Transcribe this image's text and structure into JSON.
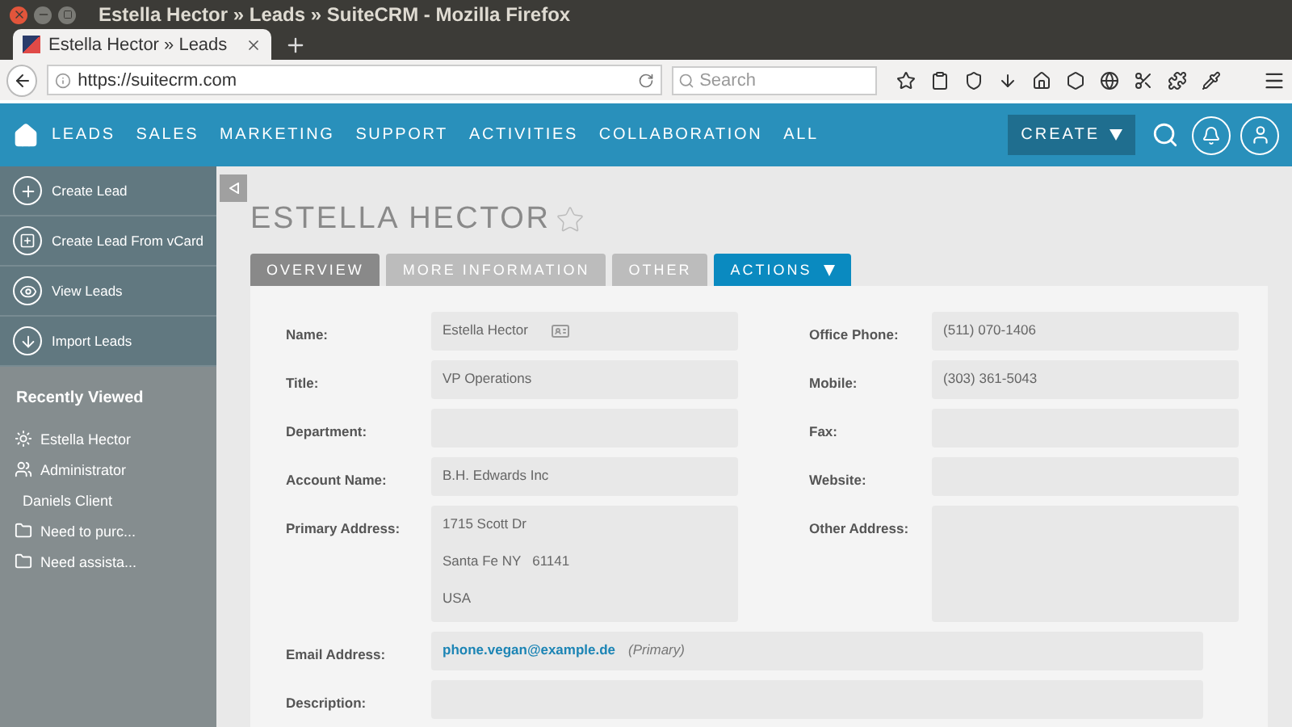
{
  "browser": {
    "window_title": "Estella Hector » Leads » SuiteCRM - Mozilla Firefox",
    "tab_title": "Estella Hector » Leads",
    "url": "https://suitecrm.com",
    "search_placeholder": "Search"
  },
  "nav": {
    "items": [
      "LEADS",
      "SALES",
      "MARKETING",
      "SUPPORT",
      "ACTIVITIES",
      "COLLABORATION",
      "ALL"
    ],
    "create": "CREATE"
  },
  "sidebar": {
    "actions": [
      {
        "label": "Create Lead",
        "kind": "plus"
      },
      {
        "label": "Create Lead From vCard",
        "kind": "vcard"
      },
      {
        "label": "View Leads",
        "kind": "eye"
      },
      {
        "label": "Import Leads",
        "kind": "download"
      }
    ],
    "recently_viewed_title": "Recently Viewed",
    "recently_viewed": [
      {
        "label": "Estella Hector",
        "kind": "lead"
      },
      {
        "label": "Administrator",
        "kind": "user"
      },
      {
        "label": "Daniels Client",
        "kind": "none"
      },
      {
        "label": "Need to purc...",
        "kind": "folder"
      },
      {
        "label": "Need assista...",
        "kind": "folder"
      }
    ]
  },
  "record": {
    "title": "ESTELLA HECTOR",
    "favorite": false,
    "tabs": [
      {
        "label": "OVERVIEW",
        "selected": true,
        "kind": "tab"
      },
      {
        "label": "MORE INFORMATION",
        "selected": false,
        "kind": "tab"
      },
      {
        "label": "OTHER",
        "selected": false,
        "kind": "tab"
      },
      {
        "label": "ACTIONS",
        "selected": false,
        "kind": "menu"
      }
    ],
    "rows": [
      {
        "cells": [
          {
            "label": "Name:",
            "kind": "text",
            "value": "Estella Hector",
            "vcard": true
          },
          {
            "label": "Office Phone:",
            "kind": "text",
            "value": "(511) 070-1406"
          }
        ]
      },
      {
        "cells": [
          {
            "label": "Title:",
            "kind": "text",
            "value": "VP Operations"
          },
          {
            "label": "Mobile:",
            "kind": "text",
            "value": "(303) 361-5043"
          }
        ]
      },
      {
        "cells": [
          {
            "label": "Department:",
            "kind": "text"
          },
          {
            "label": "Fax:",
            "kind": "text"
          }
        ]
      },
      {
        "cells": [
          {
            "label": "Account Name:",
            "kind": "text",
            "value": "B.H. Edwards Inc"
          },
          {
            "label": "Website:",
            "kind": "text"
          }
        ]
      },
      {
        "cells": [
          {
            "label": "Primary Address:",
            "kind": "address",
            "lines": [
              "1715 Scott Dr",
              "Santa Fe NY   61141",
              "USA"
            ]
          },
          {
            "label": "Other Address:",
            "kind": "address"
          }
        ]
      },
      {
        "cells": [
          {
            "label": "Email Address:",
            "kind": "email",
            "value": "phone.vegan@example.de",
            "note": "(Primary)"
          }
        ]
      },
      {
        "cells": [
          {
            "label": "Description:",
            "kind": "text"
          }
        ]
      }
    ]
  }
}
